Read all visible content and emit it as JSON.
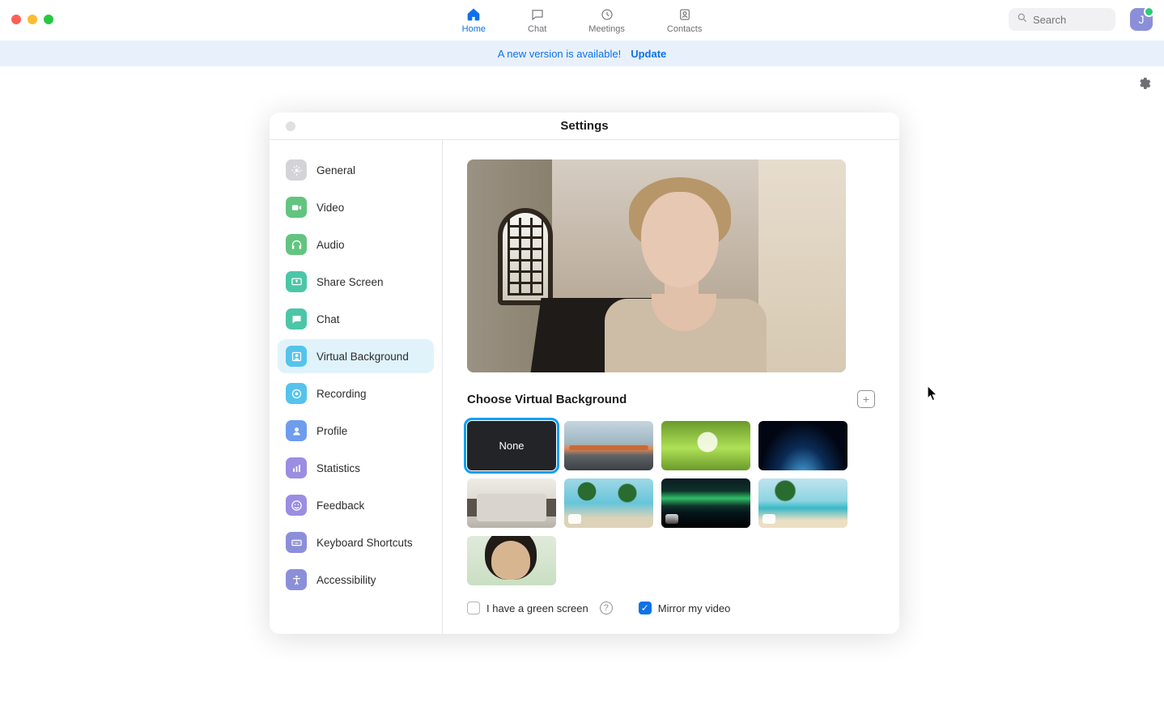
{
  "nav": {
    "items": [
      {
        "key": "home",
        "label": "Home",
        "active": true
      },
      {
        "key": "chat",
        "label": "Chat",
        "active": false
      },
      {
        "key": "meetings",
        "label": "Meetings",
        "active": false
      },
      {
        "key": "contacts",
        "label": "Contacts",
        "active": false
      }
    ]
  },
  "search": {
    "placeholder": "Search"
  },
  "avatar": {
    "initial": "J",
    "status_color": "#2ecc71"
  },
  "banner": {
    "message": "A new version is available!",
    "action": "Update"
  },
  "settings": {
    "title": "Settings",
    "sidebar": {
      "items": [
        {
          "key": "general",
          "label": "General",
          "icon": "gear",
          "color": "#d4d4d8"
        },
        {
          "key": "video",
          "label": "Video",
          "icon": "video",
          "color": "#63c480"
        },
        {
          "key": "audio",
          "label": "Audio",
          "icon": "headphones",
          "color": "#63c480"
        },
        {
          "key": "share",
          "label": "Share Screen",
          "icon": "screen",
          "color": "#4bc6a7"
        },
        {
          "key": "chat",
          "label": "Chat",
          "icon": "chat",
          "color": "#4bc6a7"
        },
        {
          "key": "vbg",
          "label": "Virtual Background",
          "icon": "portrait",
          "color": "#55c3ec",
          "active": true
        },
        {
          "key": "recording",
          "label": "Recording",
          "icon": "record",
          "color": "#55c3ec"
        },
        {
          "key": "profile",
          "label": "Profile",
          "icon": "user",
          "color": "#6e9ded"
        },
        {
          "key": "stats",
          "label": "Statistics",
          "icon": "bar",
          "color": "#9b8de2"
        },
        {
          "key": "feedback",
          "label": "Feedback",
          "icon": "smile",
          "color": "#9b8de2"
        },
        {
          "key": "keys",
          "label": "Keyboard Shortcuts",
          "icon": "keyboard",
          "color": "#8b8fd9"
        },
        {
          "key": "a11y",
          "label": "Accessibility",
          "icon": "person",
          "color": "#8b8fd9"
        }
      ]
    },
    "section_title": "Choose Virtual Background",
    "backgrounds": [
      {
        "key": "none",
        "label": "None",
        "selected": true
      },
      {
        "key": "bridge",
        "label": "Golden Gate Bridge"
      },
      {
        "key": "grass",
        "label": "Grass"
      },
      {
        "key": "space",
        "label": "Earth from Space"
      },
      {
        "key": "kitchen",
        "label": "Kitchen"
      },
      {
        "key": "palm1",
        "label": "Palm Beach",
        "video": true
      },
      {
        "key": "aurora",
        "label": "Northern Lights",
        "video": true
      },
      {
        "key": "beach",
        "label": "Tropical Beach",
        "video": true
      },
      {
        "key": "portrait",
        "label": "Custom Portrait"
      }
    ],
    "options": {
      "green_screen": {
        "label": "I have a green screen",
        "checked": false
      },
      "mirror": {
        "label": "Mirror my video",
        "checked": true
      }
    }
  }
}
